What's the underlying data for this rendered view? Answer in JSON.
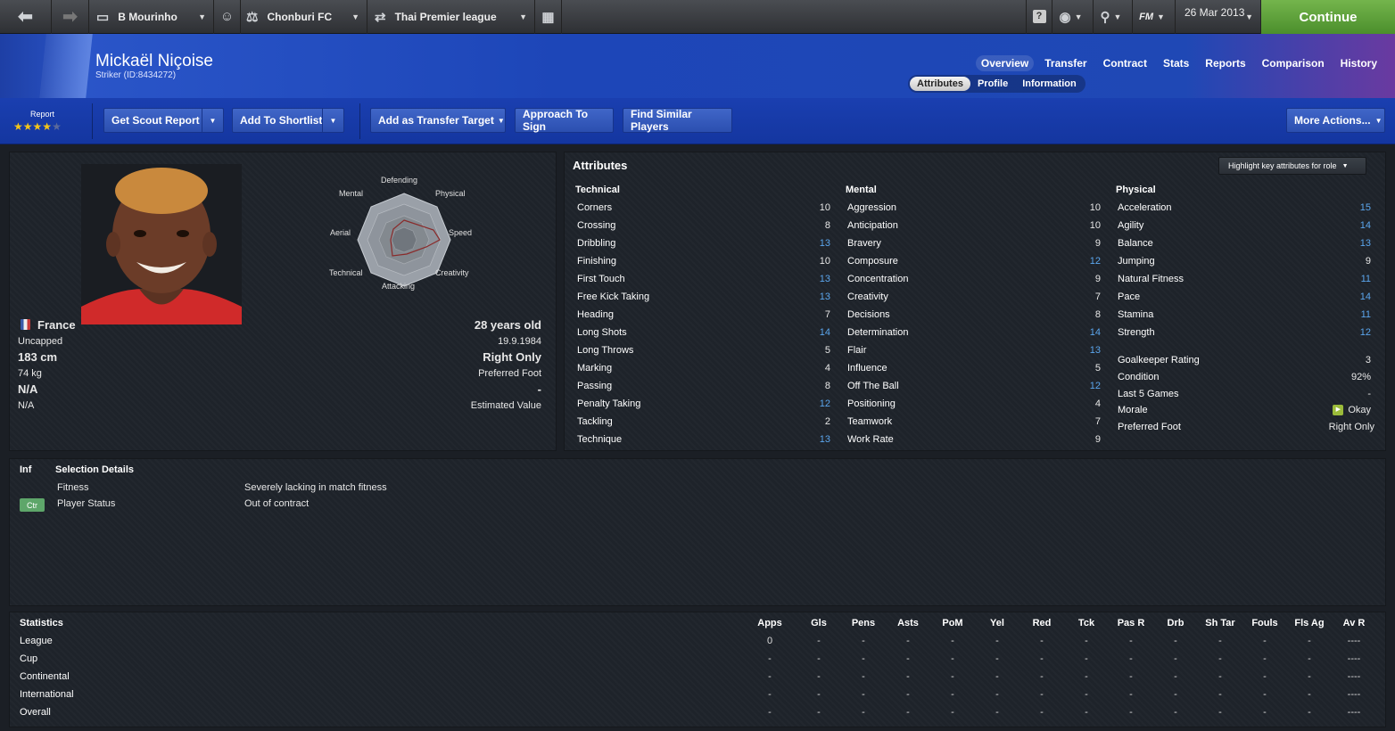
{
  "topbar": {
    "manager": "B Mourinho",
    "club": "Chonburi FC",
    "league": "Thai Premier league",
    "date": "26 Mar 2013",
    "fm_label": "FM",
    "continue": "Continue"
  },
  "header": {
    "name": "Mickaël Niçoise",
    "subtitle": "Striker (ID:8434272)",
    "nav": [
      "Overview",
      "Transfer",
      "Contract",
      "Stats",
      "Reports",
      "Comparison",
      "History"
    ],
    "subtabs": [
      "Attributes",
      "Profile",
      "Information"
    ]
  },
  "actions": {
    "report_label": "Report",
    "stars": 4,
    "get_scout_report": "Get Scout Report",
    "add_to_shortlist": "Add To Shortlist",
    "add_transfer_target": "Add as Transfer Target",
    "approach_to_sign": "Approach To Sign",
    "find_similar": "Find Similar Players",
    "more_actions": "More Actions..."
  },
  "profile": {
    "nation": "France",
    "caps": "Uncapped",
    "height": "183 cm",
    "weight": "74 kg",
    "na1": "N/A",
    "na2": "N/A",
    "age": "28 years old",
    "dob": "19.9.1984",
    "foot": "Right Only",
    "foot_label": "Preferred Foot",
    "value": "-",
    "value_label": "Estimated Value"
  },
  "radar": {
    "labels": [
      "Defending",
      "Physical",
      "Speed",
      "Creativity",
      "Attacking",
      "Technical",
      "Aerial",
      "Mental"
    ]
  },
  "attributes": {
    "title": "Attributes",
    "highlight": "Highlight key attributes for role",
    "technical_title": "Technical",
    "mental_title": "Mental",
    "physical_title": "Physical",
    "technical": [
      {
        "name": "Corners",
        "value": "10"
      },
      {
        "name": "Crossing",
        "value": "8"
      },
      {
        "name": "Dribbling",
        "value": "13"
      },
      {
        "name": "Finishing",
        "value": "10"
      },
      {
        "name": "First Touch",
        "value": "13"
      },
      {
        "name": "Free Kick Taking",
        "value": "13"
      },
      {
        "name": "Heading",
        "value": "7"
      },
      {
        "name": "Long Shots",
        "value": "14"
      },
      {
        "name": "Long Throws",
        "value": "5"
      },
      {
        "name": "Marking",
        "value": "4"
      },
      {
        "name": "Passing",
        "value": "8"
      },
      {
        "name": "Penalty Taking",
        "value": "12"
      },
      {
        "name": "Tackling",
        "value": "2"
      },
      {
        "name": "Technique",
        "value": "13"
      }
    ],
    "mental": [
      {
        "name": "Aggression",
        "value": "10"
      },
      {
        "name": "Anticipation",
        "value": "10"
      },
      {
        "name": "Bravery",
        "value": "9"
      },
      {
        "name": "Composure",
        "value": "12"
      },
      {
        "name": "Concentration",
        "value": "9"
      },
      {
        "name": "Creativity",
        "value": "7"
      },
      {
        "name": "Decisions",
        "value": "8"
      },
      {
        "name": "Determination",
        "value": "14"
      },
      {
        "name": "Flair",
        "value": "13"
      },
      {
        "name": "Influence",
        "value": "5"
      },
      {
        "name": "Off The Ball",
        "value": "12"
      },
      {
        "name": "Positioning",
        "value": "4"
      },
      {
        "name": "Teamwork",
        "value": "7"
      },
      {
        "name": "Work Rate",
        "value": "9"
      }
    ],
    "physical": [
      {
        "name": "Acceleration",
        "value": "15"
      },
      {
        "name": "Agility",
        "value": "14"
      },
      {
        "name": "Balance",
        "value": "13"
      },
      {
        "name": "Jumping",
        "value": "9"
      },
      {
        "name": "Natural Fitness",
        "value": "11"
      },
      {
        "name": "Pace",
        "value": "14"
      },
      {
        "name": "Stamina",
        "value": "11"
      },
      {
        "name": "Strength",
        "value": "12"
      }
    ],
    "extra": [
      {
        "name": "Goalkeeper Rating",
        "value": "3"
      },
      {
        "name": "Condition",
        "value": "92%"
      },
      {
        "name": "Last 5 Games",
        "value": "-"
      },
      {
        "name": "Morale",
        "value": "Okay"
      },
      {
        "name": "Preferred Foot",
        "value": "Right Only"
      }
    ]
  },
  "selection": {
    "inf": "Inf",
    "title": "Selection Details",
    "badge": "Ctr",
    "rows": [
      {
        "label": "Fitness",
        "value": "Severely lacking in match fitness"
      },
      {
        "label": "Player Status",
        "value": "Out of contract"
      }
    ]
  },
  "statistics": {
    "title": "Statistics",
    "columns": [
      "Apps",
      "Gls",
      "Pens",
      "Asts",
      "PoM",
      "Yel",
      "Red",
      "Tck",
      "Pas R",
      "Drb",
      "Sh Tar",
      "Fouls",
      "Fls Ag",
      "Av R"
    ],
    "rows": [
      {
        "label": "League",
        "cells": [
          "0",
          "-",
          "-",
          "-",
          "-",
          "-",
          "-",
          "-",
          "-",
          "-",
          "-",
          "-",
          "-",
          "----"
        ]
      },
      {
        "label": "Cup",
        "cells": [
          "-",
          "-",
          "-",
          "-",
          "-",
          "-",
          "-",
          "-",
          "-",
          "-",
          "-",
          "-",
          "-",
          "----"
        ]
      },
      {
        "label": "Continental",
        "cells": [
          "-",
          "-",
          "-",
          "-",
          "-",
          "-",
          "-",
          "-",
          "-",
          "-",
          "-",
          "-",
          "-",
          "----"
        ]
      },
      {
        "label": "International",
        "cells": [
          "-",
          "-",
          "-",
          "-",
          "-",
          "-",
          "-",
          "-",
          "-",
          "-",
          "-",
          "-",
          "-",
          "----"
        ]
      },
      {
        "label": "Overall",
        "cells": [
          "-",
          "-",
          "-",
          "-",
          "-",
          "-",
          "-",
          "-",
          "-",
          "-",
          "-",
          "-",
          "-",
          "----"
        ]
      }
    ]
  }
}
